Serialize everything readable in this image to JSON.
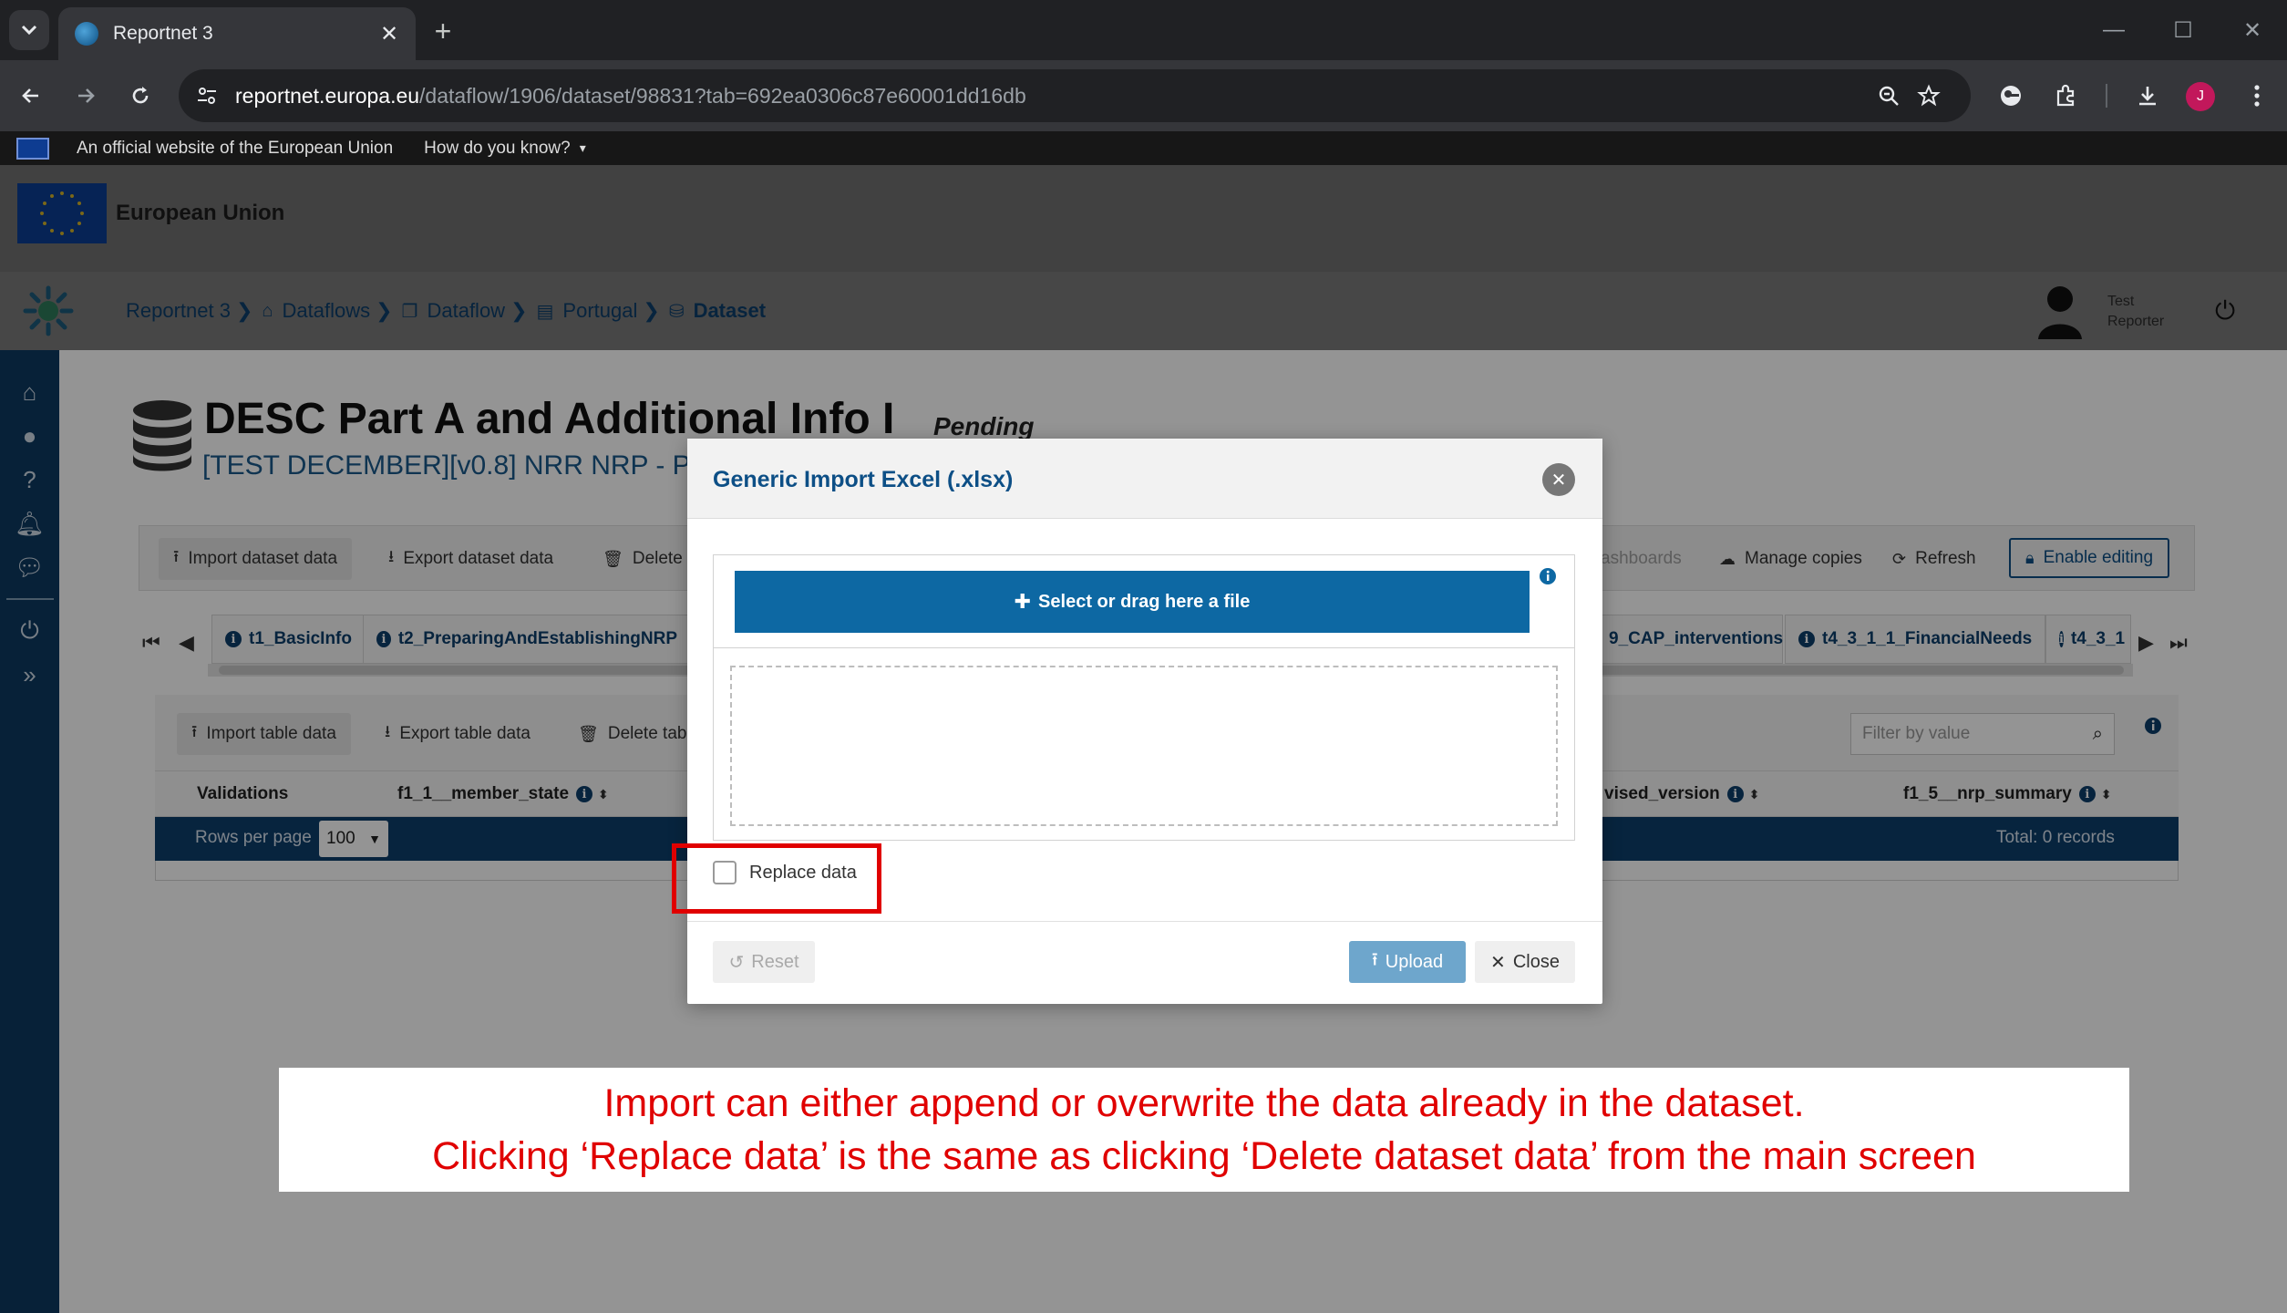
{
  "browser": {
    "tab_title": "Reportnet 3",
    "url_host": "reportnet.europa.eu",
    "url_path": "/dataflow/1906/dataset/98831?tab=692ea0306c87e60001dd16db",
    "profile_initial": "J",
    "accent": "#c2185b"
  },
  "eu_banner": {
    "official_text": "An official website of the European Union",
    "how_know": "How do you know?",
    "org_label": "European Union"
  },
  "nav": {
    "breadcrumb": [
      "Reportnet 3",
      "Dataflows",
      "Dataflow",
      "Portugal",
      "Dataset"
    ],
    "user_line1": "Test",
    "user_line2": "Reporter"
  },
  "page": {
    "title": "DESC Part A and Additional Info I",
    "status": "Pending",
    "subtitle": "[TEST DECEMBER][v0.8] NRR NRP - Portug"
  },
  "dataset_toolbar": {
    "import": "Import dataset data",
    "export": "Export dataset data",
    "delete": "Delete d",
    "dashboards": "ashboards",
    "manage_copies": "Manage copies",
    "refresh": "Refresh",
    "enable_editing": "Enable editing"
  },
  "tables_tabs": {
    "left": [
      "t1_BasicInfo",
      "t2_PreparingAndEstablishingNRP"
    ],
    "right": [
      "9_CAP_interventions",
      "t4_3_1_1_FinancialNeeds",
      "t4_3_1"
    ]
  },
  "table_toolbar": {
    "import": "Import table data",
    "export": "Export table data",
    "delete": "Delete tab",
    "filter_placeholder": "Filter by value"
  },
  "table": {
    "columns": [
      "Validations",
      "f1_1__member_state",
      "vised_version",
      "f1_5__nrp_summary"
    ],
    "rows_per_page_label": "Rows per page",
    "rows_per_page": "100",
    "total": "Total: 0 records"
  },
  "modal": {
    "title": "Generic Import Excel (.xlsx)",
    "select_file": "Select or drag here a file",
    "replace_label": "Replace data",
    "reset": "Reset",
    "upload": "Upload",
    "close": "Close"
  },
  "callout": {
    "line1": "Import can either append or overwrite the data already in the dataset.",
    "line2": "Clicking ‘Replace data’ is the same as clicking ‘Delete dataset data’ from the main screen",
    "color": "#e00000"
  }
}
